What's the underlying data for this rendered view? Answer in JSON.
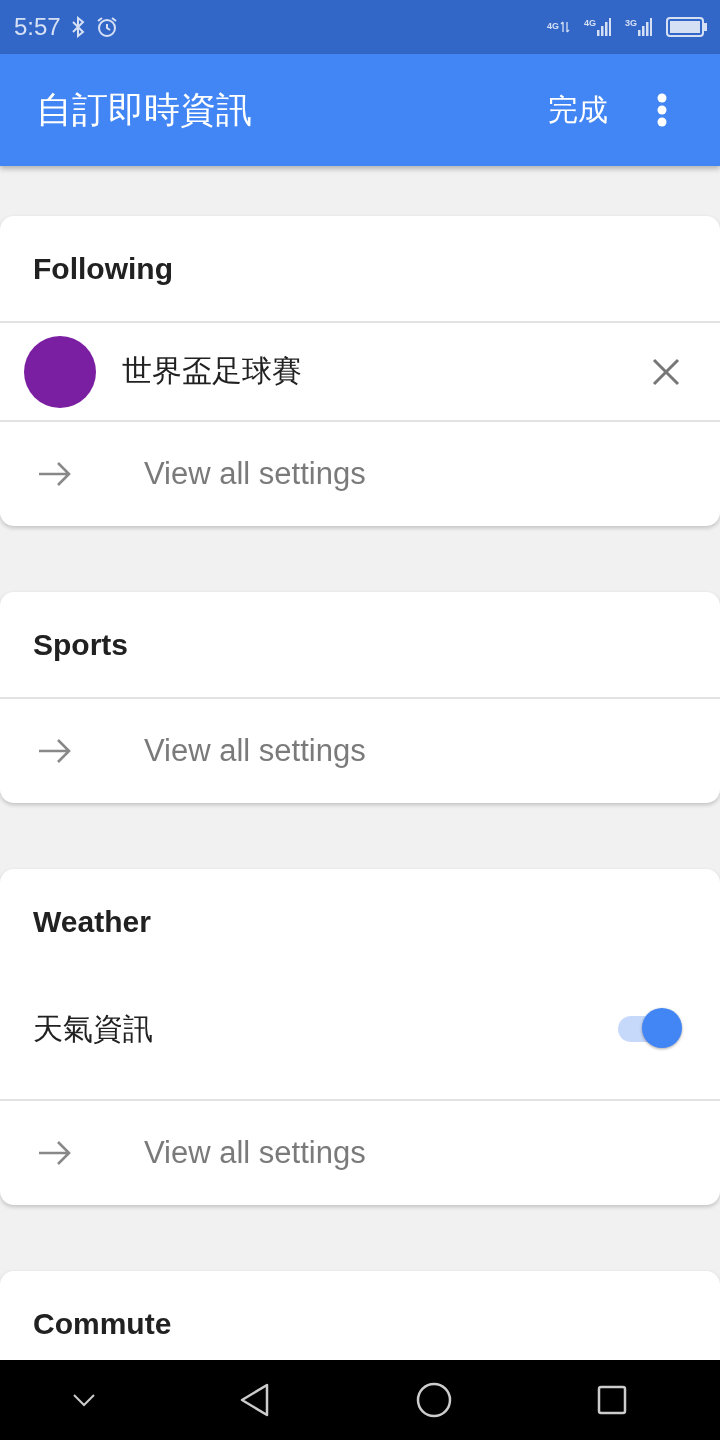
{
  "status_bar": {
    "time": "5:57",
    "network_labels": [
      "4G",
      "4G",
      "3G"
    ]
  },
  "app_bar": {
    "title": "自訂即時資訊",
    "action": "完成"
  },
  "sections": [
    {
      "title": "Following",
      "items": [
        {
          "kind": "topic",
          "label": "世界盃足球賽",
          "color": "#7b1fa2"
        },
        {
          "kind": "link",
          "label": "View all settings"
        }
      ]
    },
    {
      "title": "Sports",
      "items": [
        {
          "kind": "link",
          "label": "View all settings"
        }
      ]
    },
    {
      "title": "Weather",
      "items": [
        {
          "kind": "toggle",
          "label": "天氣資訊",
          "on": true
        },
        {
          "kind": "link",
          "label": "View all settings"
        }
      ]
    },
    {
      "title": "Commute"
    }
  ]
}
